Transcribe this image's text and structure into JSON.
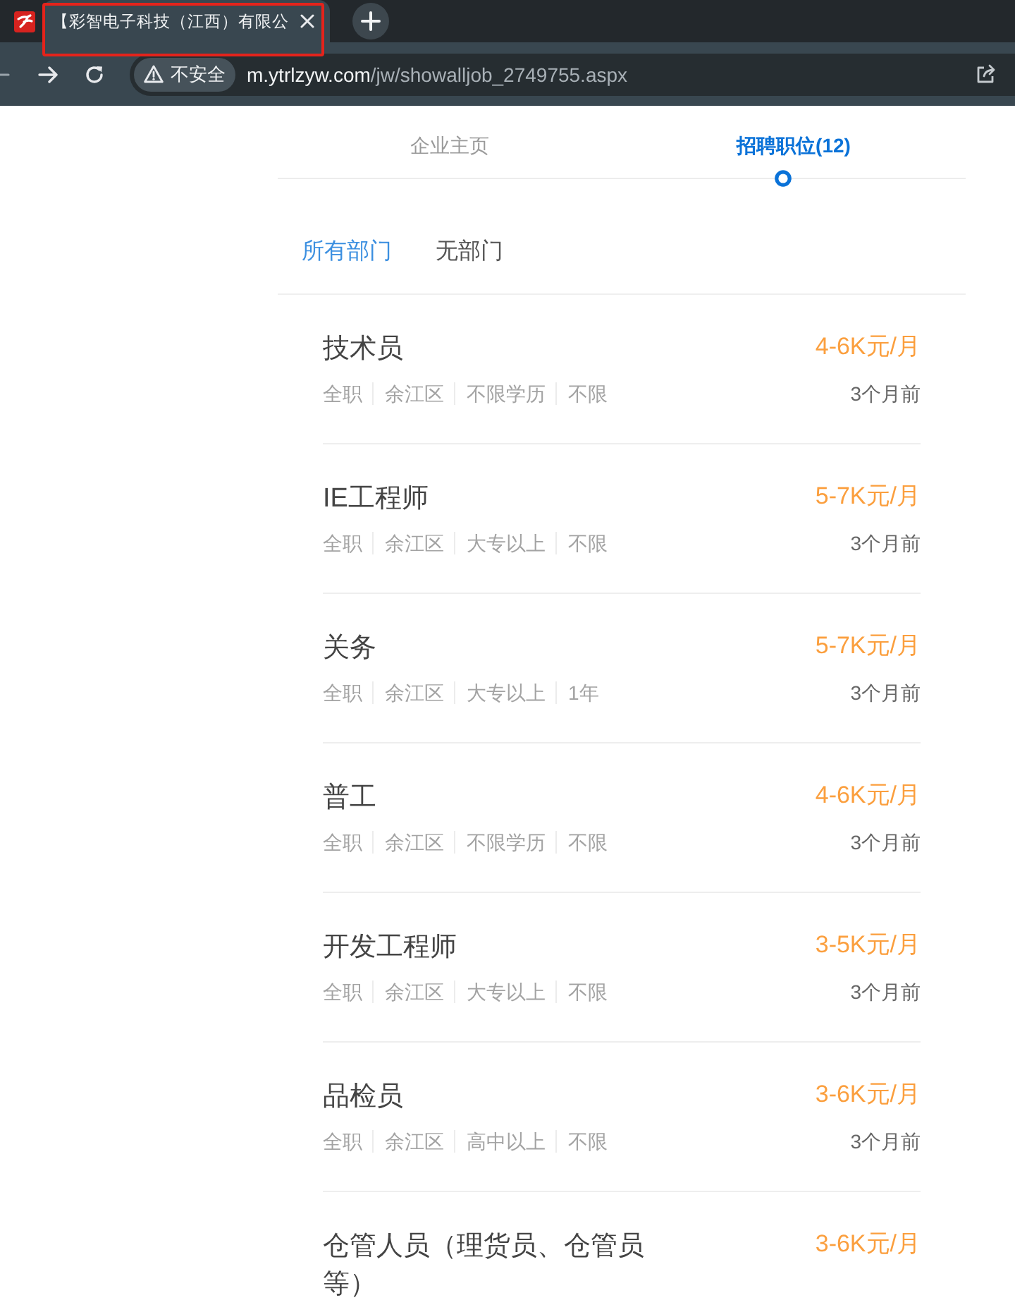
{
  "browser": {
    "tab": {
      "title": "【彩智电子科技（江西）有限公",
      "highlighted": true
    },
    "security": "不安全",
    "url": {
      "host": "m.ytrlzyw.com",
      "path": "/jw/showalljob_2749755.aspx"
    }
  },
  "tabs": [
    {
      "label": "企业主页",
      "selected": false
    },
    {
      "label": "招聘职位(12)",
      "selected": true
    }
  ],
  "departments": [
    {
      "label": "所有部门",
      "selected": true
    },
    {
      "label": "无部门",
      "selected": false
    }
  ],
  "jobs": [
    {
      "title": "技术员",
      "salary": "4-6K元/月",
      "tags": [
        "全职",
        "余江区",
        "不限学历",
        "不限"
      ],
      "posted": "3个月前"
    },
    {
      "title": "IE工程师",
      "salary": "5-7K元/月",
      "tags": [
        "全职",
        "余江区",
        "大专以上",
        "不限"
      ],
      "posted": "3个月前"
    },
    {
      "title": "关务",
      "salary": "5-7K元/月",
      "tags": [
        "全职",
        "余江区",
        "大专以上",
        "1年"
      ],
      "posted": "3个月前"
    },
    {
      "title": "普工",
      "salary": "4-6K元/月",
      "tags": [
        "全职",
        "余江区",
        "不限学历",
        "不限"
      ],
      "posted": "3个月前"
    },
    {
      "title": "开发工程师",
      "salary": "3-5K元/月",
      "tags": [
        "全职",
        "余江区",
        "大专以上",
        "不限"
      ],
      "posted": "3个月前"
    },
    {
      "title": "品检员",
      "salary": "3-6K元/月",
      "tags": [
        "全职",
        "余江区",
        "高中以上",
        "不限"
      ],
      "posted": "3个月前"
    },
    {
      "title": "仓管人员（理货员、仓管员等）",
      "salary": "3-6K元/月"
    }
  ]
}
